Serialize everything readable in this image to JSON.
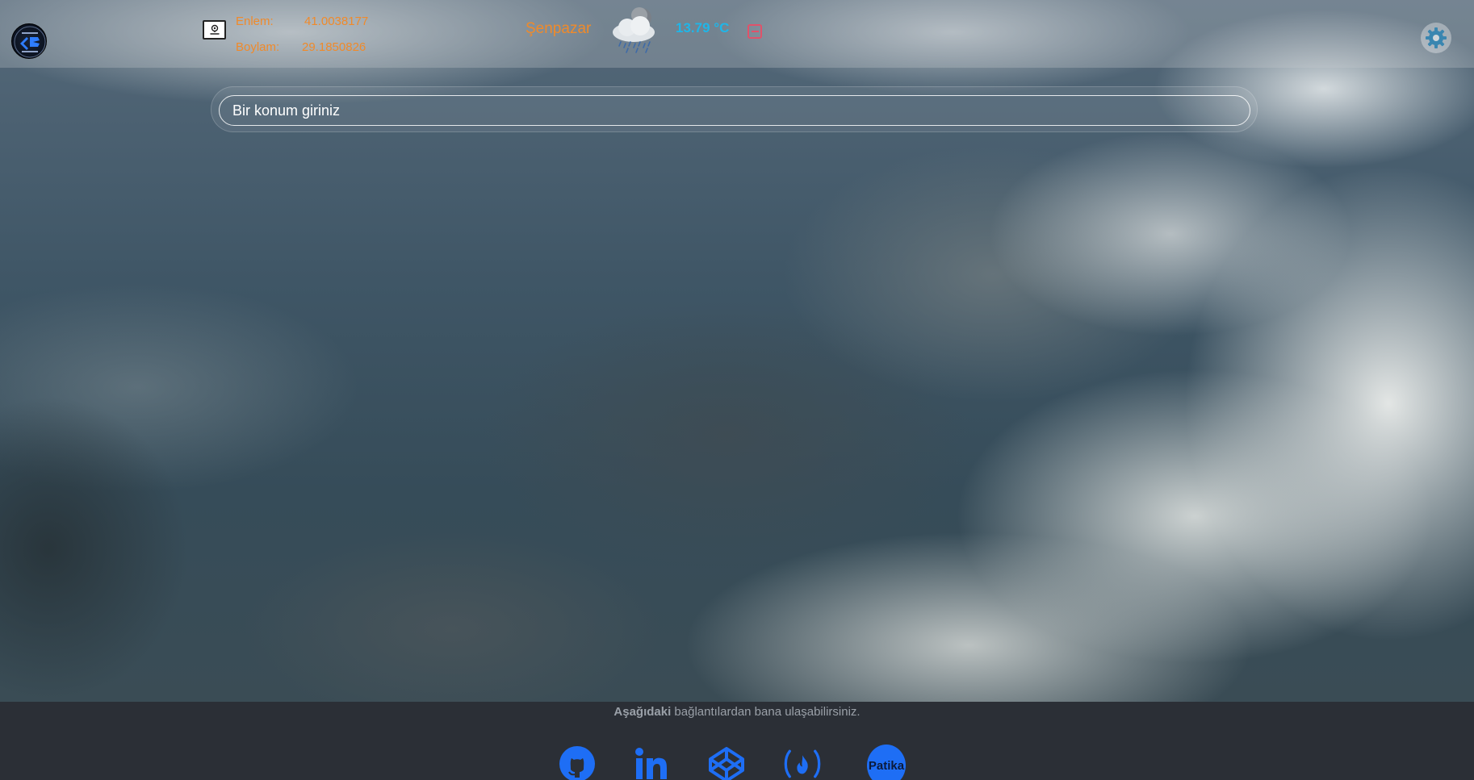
{
  "header": {
    "location_button_icon": "map-pin-icon",
    "latitude_label": "Enlem:",
    "latitude_value": "41.0038177",
    "longitude_label": "Boylam:",
    "longitude_value": "29.1850826",
    "city": "Şenpazar",
    "weather_icon": "rain-cloud-icon",
    "temperature": "13.79 °C",
    "remove_icon": "minus-square-icon",
    "settings_icon": "gear-icon"
  },
  "search": {
    "placeholder": "Bir konum giriniz"
  },
  "footer": {
    "text_bold": "Aşağıdaki",
    "text_rest": " bağlantılardan bana ulaşabilirsiniz.",
    "links": {
      "github": "github-icon",
      "linkedin": "linkedin-icon",
      "codepen": "codepen-icon",
      "freecodecamp": "freecodecamp-icon",
      "patika": "Patika"
    }
  },
  "colors": {
    "accent_orange": "#f08a2a",
    "temperature_blue": "#1fb6e8",
    "remove_red": "#e0526a",
    "social_blue": "#1e6ef5",
    "footer_bg": "#2b2f36"
  }
}
